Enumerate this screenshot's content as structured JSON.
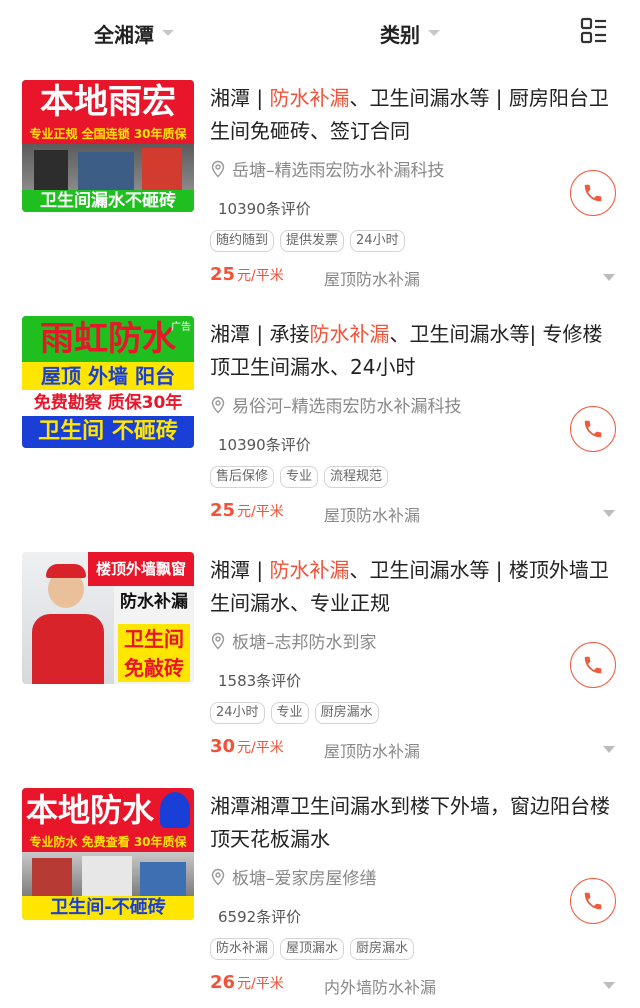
{
  "filters": {
    "area_label": "全湘潭",
    "category_label": "类别"
  },
  "items": [
    {
      "title_pre": "湘潭 | ",
      "title_hl": "防水补漏",
      "title_post": "、卫生间漏水等 | 厨房阳台卫生间免砸砖、签订合同",
      "location": "岳塘–精选雨宏防水补漏科技",
      "reviews": "10390条评价",
      "tags": [
        "随约随到",
        "提供发票",
        "24小时"
      ],
      "price": "25",
      "unit": "元/平米",
      "category": "屋顶防水补漏",
      "thumb": {
        "line1": "本地雨宏",
        "line2": "专业正规 全国连锁 30年质保",
        "line3": "卫生间漏水不砸砖"
      }
    },
    {
      "title_pre": "湘潭 | 承接",
      "title_hl": "防水补漏",
      "title_post": "、卫生间漏水等| 专修楼顶卫生间漏水、24小时",
      "location": "易俗河–精选雨宏防水补漏科技",
      "reviews": "10390条评价",
      "tags": [
        "售后保修",
        "专业",
        "流程规范"
      ],
      "price": "25",
      "unit": "元/平米",
      "category": "屋顶防水补漏",
      "thumb": {
        "line1": "雨虹防水",
        "line2": "屋顶 外墙 阳台",
        "line3": "免费勘察 质保30年",
        "line4": "卫生间 不砸砖",
        "badge": "广告"
      }
    },
    {
      "title_pre": "湘潭 | ",
      "title_hl": "防水补漏",
      "title_post": "、卫生间漏水等 | 楼顶外墙卫生间漏水、专业正规",
      "location": "板塘–志邦防水到家",
      "reviews": "1583条评价",
      "tags": [
        "24小时",
        "专业",
        "厨房漏水"
      ],
      "price": "30",
      "unit": "元/平米",
      "category": "屋顶防水补漏",
      "thumb": {
        "line1": "楼顶外墙飘窗",
        "line2": "防水补漏",
        "line3": "卫生间",
        "line4": "免敲砖"
      }
    },
    {
      "title_pre": "湘潭湘潭卫生间漏水到楼下外墙，窗边阳台楼顶天花板漏水",
      "title_hl": "",
      "title_post": "",
      "location": "板塘–爱家房屋修缮",
      "reviews": "6592条评价",
      "tags": [
        "防水补漏",
        "屋顶漏水",
        "厨房漏水"
      ],
      "price": "26",
      "unit": "元/平米",
      "category": "内外墙防水补漏",
      "thumb": {
        "line1": "本地防水",
        "line2": "专业防水 免费查看 30年质保",
        "line3": "卫生间-不砸砖"
      }
    }
  ],
  "colors": {
    "accent": "#f0533a",
    "thumb_red": "#e8152b",
    "thumb_green": "#1fbf1f",
    "thumb_blue": "#1a3fd6",
    "thumb_yellow": "#ffe600"
  },
  "icons": {
    "layout": "list-layout-icon",
    "location": "location-pin-icon",
    "phone": "phone-icon"
  }
}
